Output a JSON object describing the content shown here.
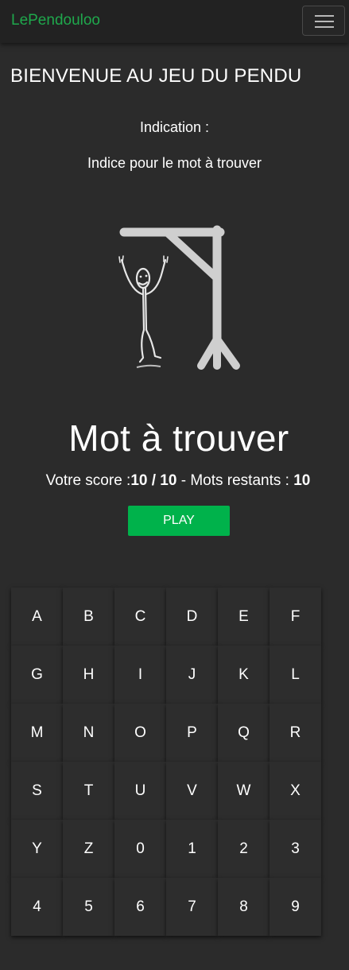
{
  "navbar": {
    "brand": "LePendouloo",
    "brand_color": "#1fa84c",
    "menu_icon": "hamburger-menu-icon"
  },
  "main": {
    "title": "BIENVENUE AU JEU DU PENDU",
    "indication_label": "Indication :",
    "hint": "Indice pour le mot à trouver",
    "hangman_image": "hangman-drawing",
    "word": "Mot à trouver",
    "score": {
      "label": "Votre score :",
      "value": "10 / 10",
      "separator": " - ",
      "remaining_label": "Mots restants : ",
      "remaining_value": "10"
    },
    "play_label": "PLAY",
    "play_color": "#00b24b"
  },
  "keyboard": {
    "keys": [
      "A",
      "B",
      "C",
      "D",
      "E",
      "F",
      "G",
      "H",
      "I",
      "J",
      "K",
      "L",
      "M",
      "N",
      "O",
      "P",
      "Q",
      "R",
      "S",
      "T",
      "U",
      "V",
      "W",
      "X",
      "Y",
      "Z",
      "0",
      "1",
      "2",
      "3",
      "4",
      "5",
      "6",
      "7",
      "8",
      "9"
    ]
  }
}
